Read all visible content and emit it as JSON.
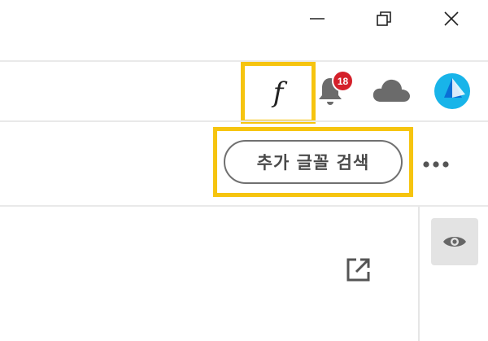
{
  "window": {
    "minimize_icon": "minimize-icon",
    "maximize_icon": "restore-icon",
    "close_icon": "close-icon"
  },
  "toolbar": {
    "font_button_glyph": "f",
    "notifications": {
      "icon": "bell-icon",
      "count": "18",
      "badge_color": "#d4202a"
    },
    "cloud_icon": "cloud-icon",
    "avatar_colors": {
      "primary": "#18b4e9",
      "secondary": "#0a6fd6"
    }
  },
  "search_row": {
    "search_fonts_label": "추가 글꼴 검색",
    "more_icon": "more-horizontal-icon"
  },
  "content": {
    "visibility_icon": "eye-icon",
    "open_external_icon": "open-external-icon"
  },
  "colors": {
    "highlight": "#f6c40f",
    "divider": "#e9e9e9"
  }
}
